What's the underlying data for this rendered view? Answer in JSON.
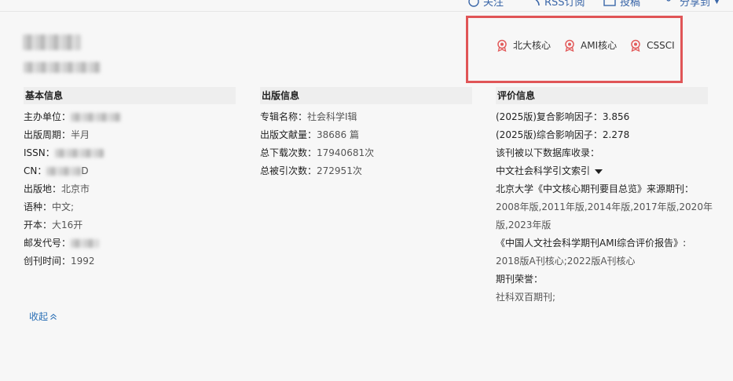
{
  "top_nav": {
    "follow": "关注",
    "rss": "RSS订阅",
    "submit": "投稿",
    "share": "分享到"
  },
  "badges": [
    {
      "label": "北大核心",
      "icon": "award-icon"
    },
    {
      "label": "AMI核心",
      "icon": "award-icon"
    },
    {
      "label": "CSSCI",
      "icon": "award-icon"
    }
  ],
  "colors": {
    "badge_border": "#e05557",
    "link": "#2a6fb5",
    "badge_icon": "#e25b5b"
  },
  "basic_info": {
    "title": "基本信息",
    "sponsor_label": "主办单位：",
    "cycle_label": "出版周期：",
    "cycle_value": "半月",
    "issn_label": "ISSN：",
    "cn_label": "CN：",
    "cn_value_suffix": "D",
    "place_label": "出版地：",
    "place_value": "北京市",
    "language_label": "语种：",
    "language_value": "中文;",
    "format_label": "开本：",
    "format_value": "大16开",
    "postcode_label": "邮发代号：",
    "founded_label": "创刊时间：",
    "founded_value": "1992"
  },
  "publish_info": {
    "title": "出版信息",
    "series_label": "专辑名称：",
    "series_value": "社会科学Ⅰ辑",
    "docs_label": "出版文献量：",
    "docs_value": "38686 篇",
    "downloads_label": "总下载次数：",
    "downloads_value": "17940681次",
    "cites_label": "总被引次数：",
    "cites_value": "272951次"
  },
  "eval_info": {
    "title": "评价信息",
    "composite_if": "(2025版)复合影响因子：3.856",
    "comprehensive_if": "(2025版)综合影响因子：2.278",
    "db_label": "该刊被以下数据库收录：",
    "db_value": "中文社会科学引文索引",
    "pku_label": "北京大学《中文核心期刊要目总览》来源期刊：",
    "pku_years_1": "2008年版,2011年版,2014年版,2017年版,2020年",
    "pku_years_2": "版,2023年版",
    "ami_label": "《中国人文社会科学期刊AMI综合评价报告》:",
    "ami_value": "2018版A刊核心;2022版A刊核心",
    "honor_label": "期刊荣誉：",
    "honor_value": "社科双百期刊;"
  },
  "collapse_label": "收起"
}
